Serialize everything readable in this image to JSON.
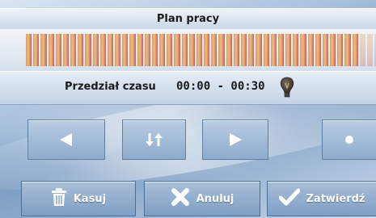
{
  "title": "Plan pracy",
  "schedule": {
    "bar_count": 48,
    "bars_faded_end": 3
  },
  "timeline": {
    "label": "Przedział czasu",
    "time_range": "00:00 - 00:30",
    "icon": "bulb-icon"
  },
  "nav": {
    "prev": "left-arrow-icon",
    "swap": "swap-arrows-icon",
    "next": "right-arrow-icon",
    "dot": "dot-icon"
  },
  "actions": {
    "delete_label": "Kasuj",
    "cancel_label": "Anuluj",
    "confirm_label": "Zatwierdź"
  },
  "colors": {
    "bar_warm": "#f0b070",
    "bar_red": "#c24a3a",
    "accent_blue": "#8eabcc"
  }
}
